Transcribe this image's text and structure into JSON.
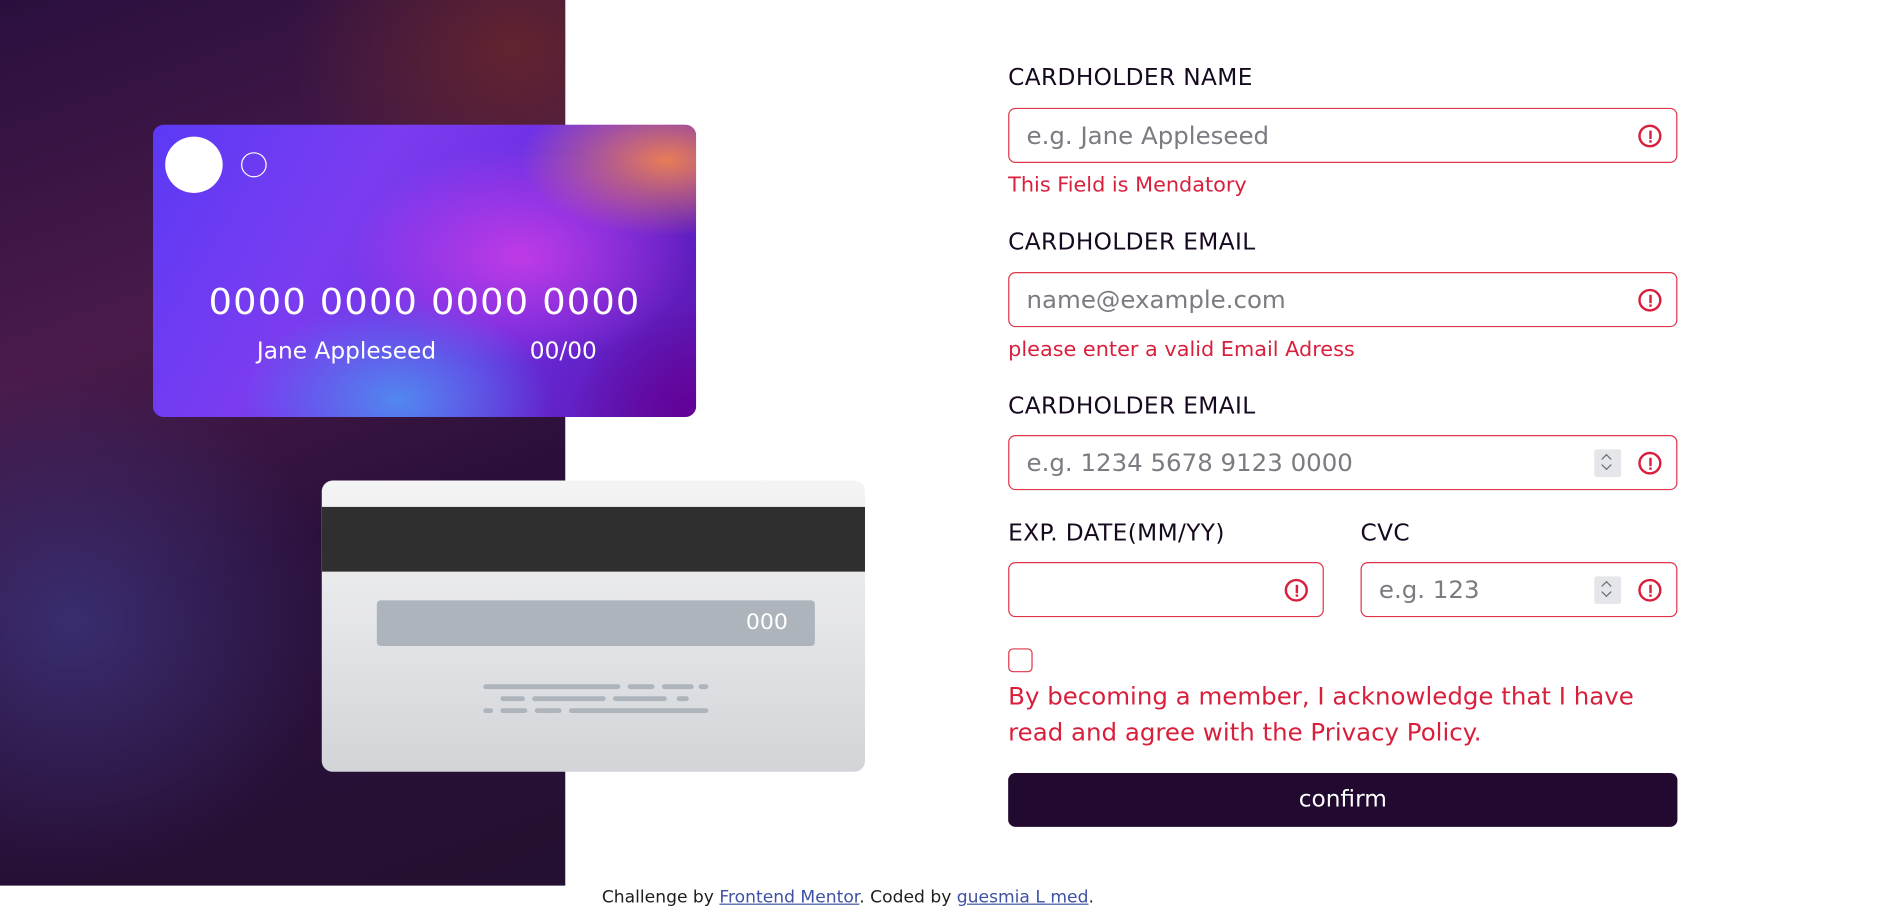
{
  "card_front": {
    "number": "0000 0000 0000 0000",
    "name": "Jane Appleseed",
    "exp": "00/00"
  },
  "card_back": {
    "cvc": "000"
  },
  "form": {
    "name_label": "CARDHOLDER NAME",
    "name_placeholder": "e.g. Jane Appleseed",
    "name_error": "This Field is Mendatory",
    "email_label": "CARDHOLDER EMAIL",
    "email_placeholder": "name@example.com",
    "email_error": "please enter a valid Email Adress",
    "number_label": "CARDHOLDER EMAIL",
    "number_placeholder": "e.g. 1234 5678 9123 0000",
    "exp_label": "EXP. DATE(MM/YY)",
    "exp_placeholder": "",
    "cvc_label": "CVC",
    "cvc_placeholder": "e.g. 123",
    "policy_text": "By becoming a member, I acknowledge that I have read and agree with the Privacy Policy.",
    "confirm_label": "confirm"
  },
  "footer": {
    "prefix": "Challenge by ",
    "link1": "Frontend Mentor",
    "middle": ". Coded by ",
    "link2": "guesmia L med",
    "suffix": "."
  },
  "colors": {
    "error": "#d81f3c",
    "button_bg": "#21092f",
    "link": "#3e52a3"
  },
  "icons": [
    "error-circle-icon",
    "spinner-up-icon",
    "spinner-down-icon"
  ]
}
